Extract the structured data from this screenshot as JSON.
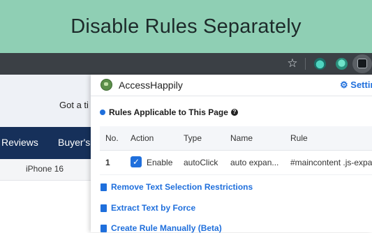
{
  "banner": {
    "title": "Disable Rules Separately"
  },
  "toolbar": {
    "star_icon": "star-icon",
    "extensions": [
      "accesshappily-extension-icon",
      "extension-icon",
      "extension-icon"
    ]
  },
  "website": {
    "promo_text": "Got a ti",
    "nav": [
      "Reviews",
      "Buyer's"
    ],
    "subnav": [
      "iPhone 16"
    ]
  },
  "popup": {
    "app_title": "AccessHappily",
    "settings_label": "Settin",
    "section_title": "Rules Applicable to This Page",
    "table": {
      "headers": [
        "No.",
        "Action",
        "Type",
        "Name",
        "Rule"
      ],
      "rows": [
        {
          "no": "1",
          "enabled": true,
          "action": "Enable",
          "type": "autoClick",
          "name": "auto expan...",
          "rule": "#maincontent .js-expa"
        }
      ]
    },
    "links": [
      {
        "label": "Remove Text Selection Restrictions",
        "icon": "document-icon"
      },
      {
        "label": "Extract Text by Force",
        "icon": "extract-icon"
      },
      {
        "label": "Create Rule Manually (Beta)",
        "icon": "edit-icon"
      }
    ]
  },
  "colors": {
    "banner_bg": "#8fcfb4",
    "accent": "#1f6fdc",
    "nav_bg": "#16305a",
    "toolbar_bg": "#3b4045"
  }
}
